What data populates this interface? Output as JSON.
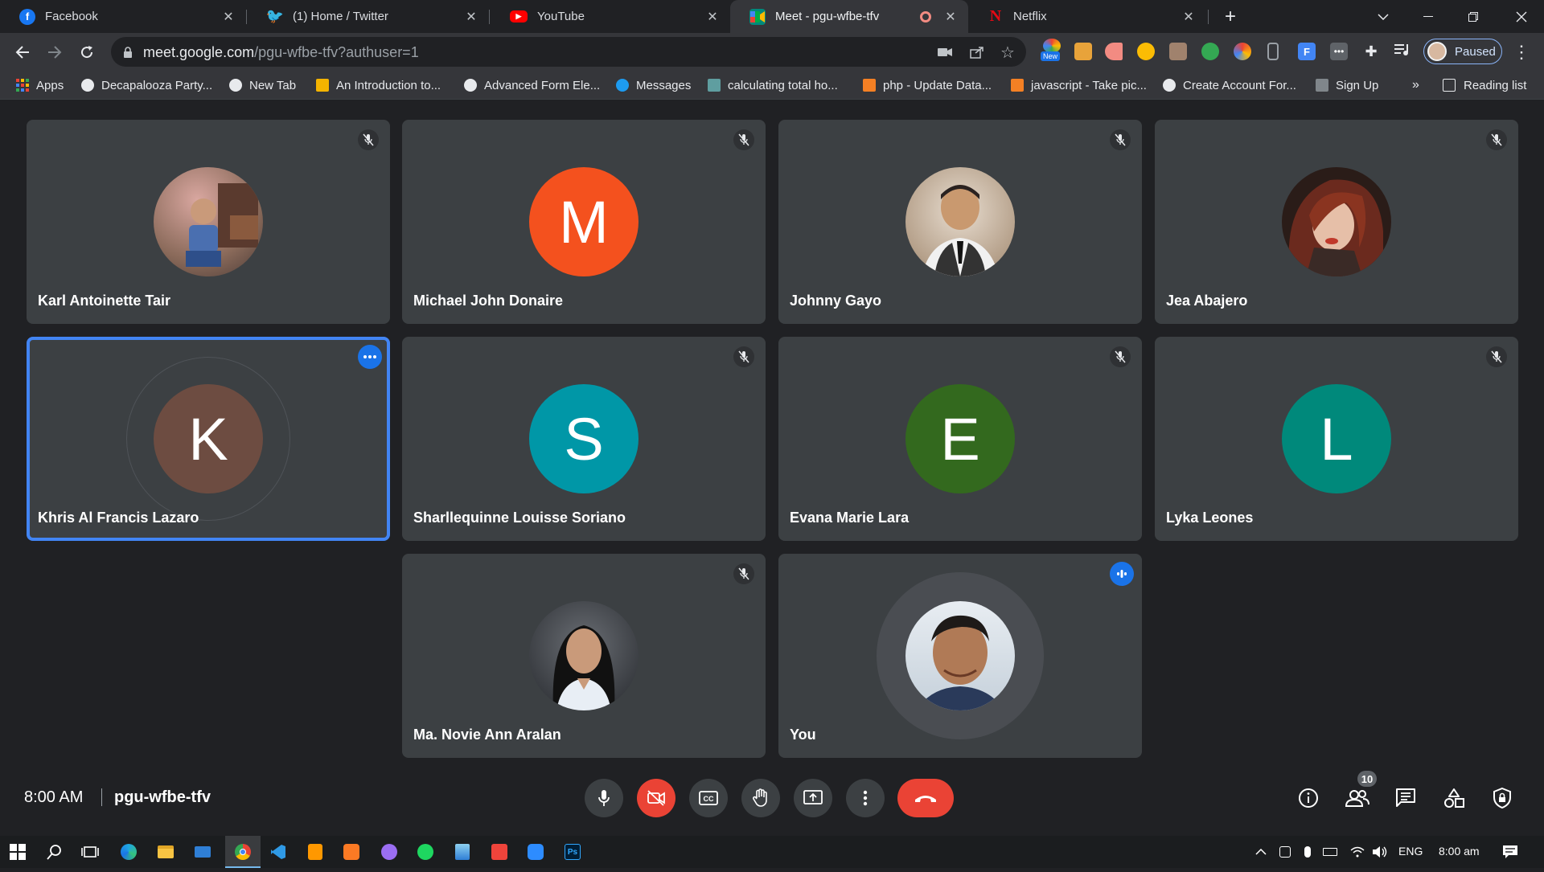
{
  "browser": {
    "tabs": [
      {
        "title": "Facebook",
        "icon": "facebook-icon",
        "color": "#1877f2"
      },
      {
        "title": "(1) Home / Twitter",
        "icon": "twitter-icon",
        "color": "#1d9bf0"
      },
      {
        "title": "YouTube",
        "icon": "youtube-icon",
        "color": "#ff0000"
      },
      {
        "title": "Meet - pgu-wfbe-tfv",
        "icon": "meet-icon",
        "color": "#00897b",
        "active": true
      },
      {
        "title": "Netflix",
        "icon": "netflix-icon",
        "color": "#e50914"
      }
    ],
    "url_host": "meet.google.com",
    "url_path": "/pgu-wfbe-tfv?authuser=1",
    "profile_label": "Paused",
    "new_badge": "New",
    "bookmarks": [
      "Apps",
      "Decapalooza Party...",
      "New Tab",
      "An Introduction to...",
      "Advanced Form Ele...",
      "Messages",
      "calculating total ho...",
      "php - Update Data...",
      "javascript - Take pic...",
      "Create Account For...",
      "Sign Up"
    ],
    "overflow": "»",
    "reading_list": "Reading list"
  },
  "meeting": {
    "participants": [
      {
        "name": "Karl Antoinette Tair",
        "initial": "",
        "color": "#8a6a5a",
        "muted": true,
        "photo": true
      },
      {
        "name": "Michael John Donaire",
        "initial": "M",
        "color": "#f4511e",
        "muted": true,
        "photo": false
      },
      {
        "name": "Johnny Gayo",
        "initial": "",
        "color": "#c9b7a2",
        "muted": true,
        "photo": true
      },
      {
        "name": "Jea Abajero",
        "initial": "",
        "color": "#5a3a30",
        "muted": true,
        "photo": true
      },
      {
        "name": "Khris Al Francis Lazaro",
        "initial": "K",
        "color": "#6d4c41",
        "muted": false,
        "photo": false,
        "speaking": true
      },
      {
        "name": "Sharllequinne Louisse Soriano",
        "initial": "S",
        "color": "#0097a7",
        "muted": true,
        "photo": false
      },
      {
        "name": "Evana Marie Lara",
        "initial": "E",
        "color": "#33691e",
        "muted": true,
        "photo": false
      },
      {
        "name": "Lyka Leones",
        "initial": "L",
        "color": "#00897b",
        "muted": true,
        "photo": false
      },
      {
        "name": "Ma. Novie Ann Aralan",
        "initial": "",
        "color": "#4a4d52",
        "muted": true,
        "photo": true
      },
      {
        "name": "You",
        "initial": "",
        "color": "#b0c4de",
        "muted": false,
        "photo": true
      }
    ],
    "clock": "8:00 AM",
    "code": "pgu-wfbe-tfv",
    "people_count": "10"
  },
  "taskbar": {
    "lang": "ENG",
    "time": "8:00 am"
  },
  "colors": {
    "accent_blue": "#1a73e8",
    "hangup_red": "#ea4335",
    "tile_bg": "#3c4043",
    "page_bg": "#202124"
  }
}
